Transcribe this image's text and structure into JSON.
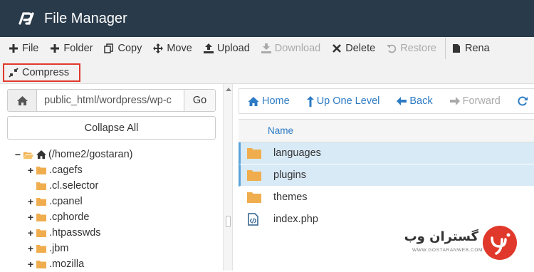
{
  "header": {
    "title": "File Manager",
    "logo": "cpanel-logo"
  },
  "toolbar": {
    "file": "File",
    "folder": "Folder",
    "copy": "Copy",
    "move": "Move",
    "upload": "Upload",
    "download": "Download",
    "delete": "Delete",
    "restore": "Restore",
    "rename": "Rena",
    "compress": "Compress"
  },
  "left": {
    "path_value": "public_html/wordpress/wp-c",
    "go_label": "Go",
    "collapse_label": "Collapse All",
    "tree": [
      {
        "label": "(/home2/gostaran)",
        "toggle": "−"
      },
      {
        "label": ".cagefs",
        "toggle": "+"
      },
      {
        "label": ".cl.selector",
        "toggle": ""
      },
      {
        "label": ".cpanel",
        "toggle": "+"
      },
      {
        "label": ".cphorde",
        "toggle": "+"
      },
      {
        "label": ".htpasswds",
        "toggle": "+"
      },
      {
        "label": ".jbm",
        "toggle": "+"
      },
      {
        "label": ".mozilla",
        "toggle": "+"
      }
    ]
  },
  "right": {
    "nav": {
      "home": "Home",
      "up": "Up One Level",
      "back": "Back",
      "forward": "Forward"
    },
    "column_name": "Name",
    "files": [
      {
        "name": "languages",
        "type": "folder",
        "selected": true
      },
      {
        "name": "plugins",
        "type": "folder",
        "selected": true
      },
      {
        "name": "themes",
        "type": "folder",
        "selected": false
      },
      {
        "name": "index.php",
        "type": "code-file",
        "selected": false
      }
    ]
  },
  "watermark": {
    "text": "گستران وب",
    "url": "WWW.GOSTARANWEB.COM"
  },
  "colors": {
    "header": "#293a4a",
    "link": "#2d7bc4",
    "folder": "#f0ad4e",
    "selected": "#d9eaf7",
    "highlight": "#e0392b"
  }
}
